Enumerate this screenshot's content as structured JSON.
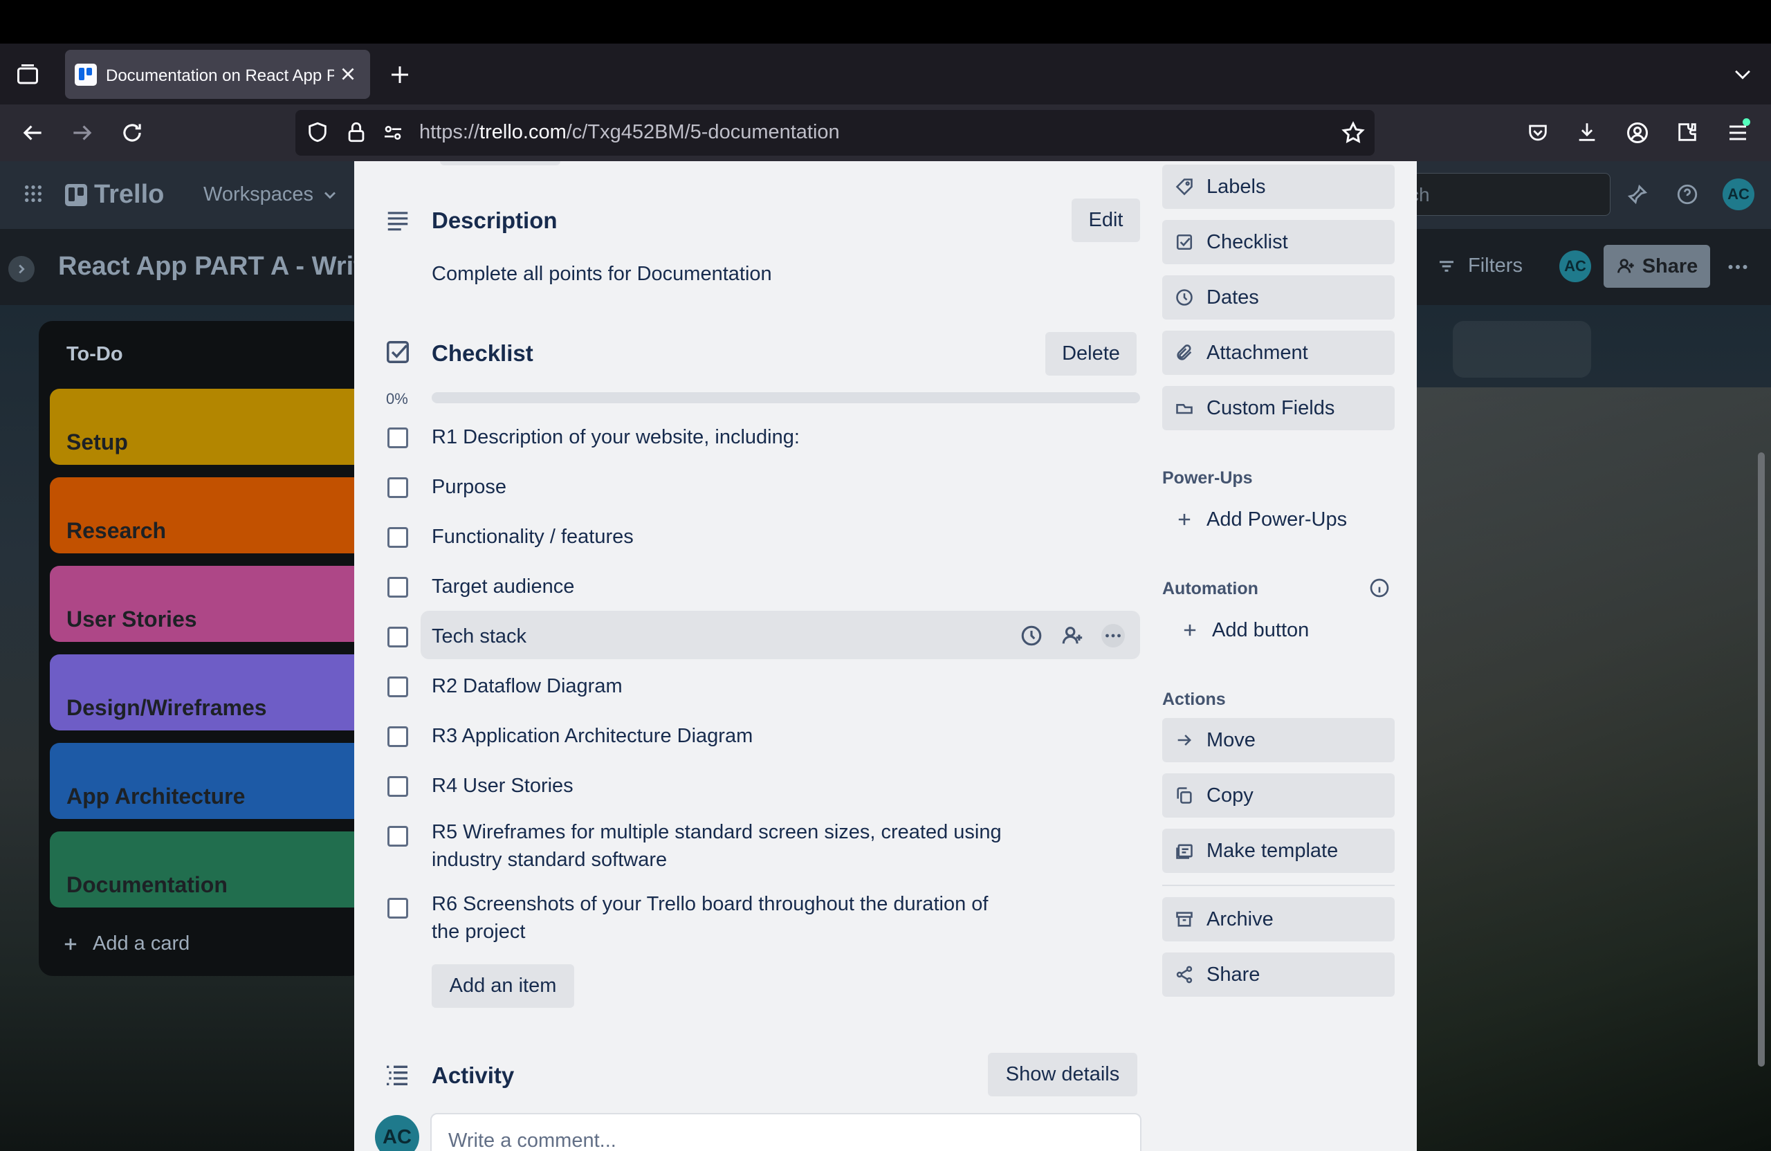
{
  "browser": {
    "tab_title": "Documentation on React App P/",
    "url_prefix": "https://",
    "url_domain": "trello.com",
    "url_path": "/c/Txg452BM/5-documentation"
  },
  "trello": {
    "logo_text": "Trello",
    "workspaces_label": "Workspaces",
    "search_placeholder": "ch",
    "avatar_initials": "AC"
  },
  "board": {
    "title": "React App PART A - Writ",
    "filters_label": "Filters",
    "share_label": "Share",
    "list_title": "To-Do",
    "cards": [
      {
        "label": "Setup",
        "color": "#b38600"
      },
      {
        "label": "Research",
        "color": "#c25100"
      },
      {
        "label": "User Stories",
        "color": "#ae4787"
      },
      {
        "label": "Design/Wireframes",
        "color": "#6e5dc6"
      },
      {
        "label": "App Architecture",
        "color": "#1d5aa6"
      },
      {
        "label": "Documentation",
        "color": "#216e4e"
      }
    ],
    "add_card_label": "Add a card"
  },
  "card_modal": {
    "description_title": "Description",
    "description_edit": "Edit",
    "description_text": "Complete all points for Documentation",
    "checklist_title": "Checklist",
    "checklist_delete": "Delete",
    "progress_text": "0%",
    "progress_value": 0,
    "checklist_items": [
      "R1 Description of your website, including:",
      "Purpose",
      "Functionality / features",
      "Target audience",
      "Tech stack",
      "R2 Dataflow Diagram",
      "R3 Application Architecture Diagram",
      "R4 User Stories",
      "R5 Wireframes for multiple standard screen sizes, created using",
      "industry standard software",
      "R6 Screenshots of your Trello board throughout the duration of",
      "the project"
    ],
    "add_item_label": "Add an item",
    "activity_title": "Activity",
    "show_details_label": "Show details",
    "comment_placeholder": "Write a comment...",
    "avatar_initials": "AC"
  },
  "sidebar": {
    "add_to_card": [
      "Labels",
      "Checklist",
      "Dates",
      "Attachment",
      "Custom Fields"
    ],
    "powerups_heading": "Power-Ups",
    "add_powerups_label": "Add Power-Ups",
    "automation_heading": "Automation",
    "add_button_label": "Add button",
    "actions_heading": "Actions",
    "actions": [
      "Move",
      "Copy",
      "Make template"
    ],
    "archive_label": "Archive",
    "share_label": "Share"
  },
  "colors": {
    "avatar": "#1f7a8c",
    "accent_blue": "#0c66e4"
  }
}
